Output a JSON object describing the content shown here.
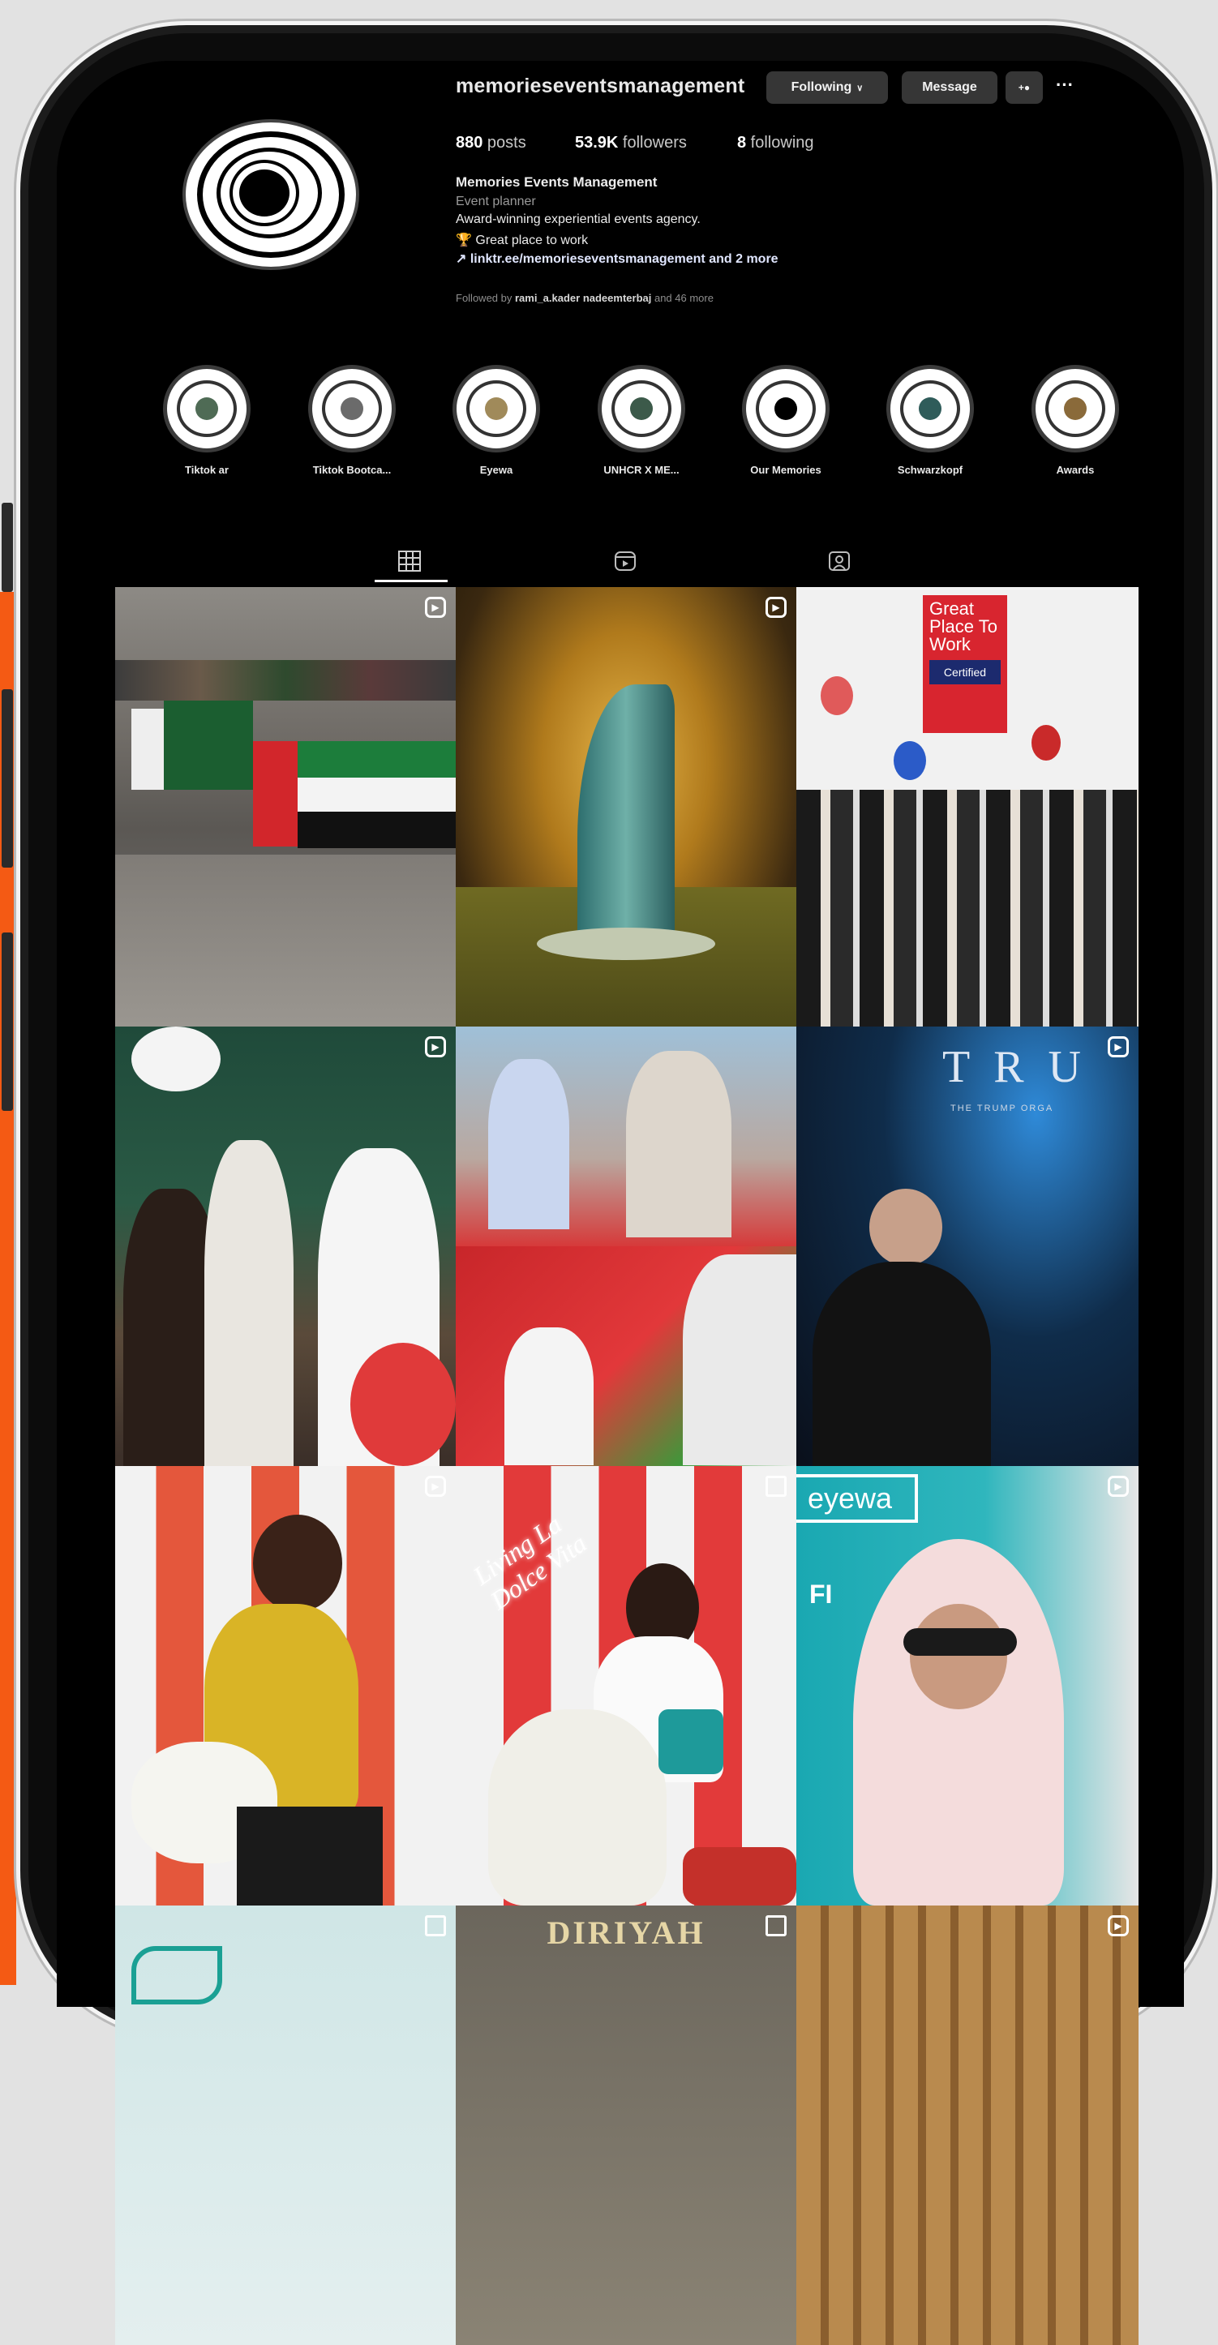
{
  "profile": {
    "username": "memorieseventsmanagement",
    "following_label": "Following",
    "message_label": "Message",
    "more_label": "···",
    "add_person_label": "+●",
    "posts_count": "880",
    "posts_label": " posts",
    "followers_count": "53.9K",
    "followers_label": " followers",
    "following_count": "8",
    "following_text": " following",
    "name": "Memories Events Management",
    "category": "Event planner",
    "description": "Award-winning experiential events agency.",
    "work": "🏆 Great place to work",
    "link": "↗ linktr.ee/memorieseventsmanagement and 2 more",
    "followed_by_prefix": "Followed by ",
    "followed_by_names": "rami_a.kader nadeemterbaj",
    "followed_by_suffix": " and 46 more"
  },
  "highlights": [
    {
      "label": "Tiktok ar",
      "dot": "#4f6b55"
    },
    {
      "label": "Tiktok Bootca...",
      "dot": "#6b6b6b"
    },
    {
      "label": "Eyewa",
      "dot": "#a08a5a"
    },
    {
      "label": "UNHCR X ME...",
      "dot": "#3c5a4a"
    },
    {
      "label": "Our Memories",
      "dot": "#000000"
    },
    {
      "label": "Schwarzkopf",
      "dot": "#2f5c5a"
    },
    {
      "label": "Awards",
      "dot": "#8a6a3a"
    }
  ],
  "tabs": {
    "posts_icon": "grid-icon",
    "reels_icon": "reels-icon",
    "tagged_icon": "tagged-icon"
  },
  "posts": {
    "gptw_title": "Great Place To Work",
    "gptw_cert": "Certified",
    "trump_text": "T R U",
    "trump_sub": "THE TRUMP ORGA",
    "eyewa_text": "eyewa",
    "eyewa_sub": "FI",
    "diriyah_text": "DIRIYAH",
    "dolce_text": "Living La Dolce Vita"
  },
  "colors": {
    "accent_orange": "#f45a14",
    "background": "#000000",
    "button": "#363636"
  }
}
